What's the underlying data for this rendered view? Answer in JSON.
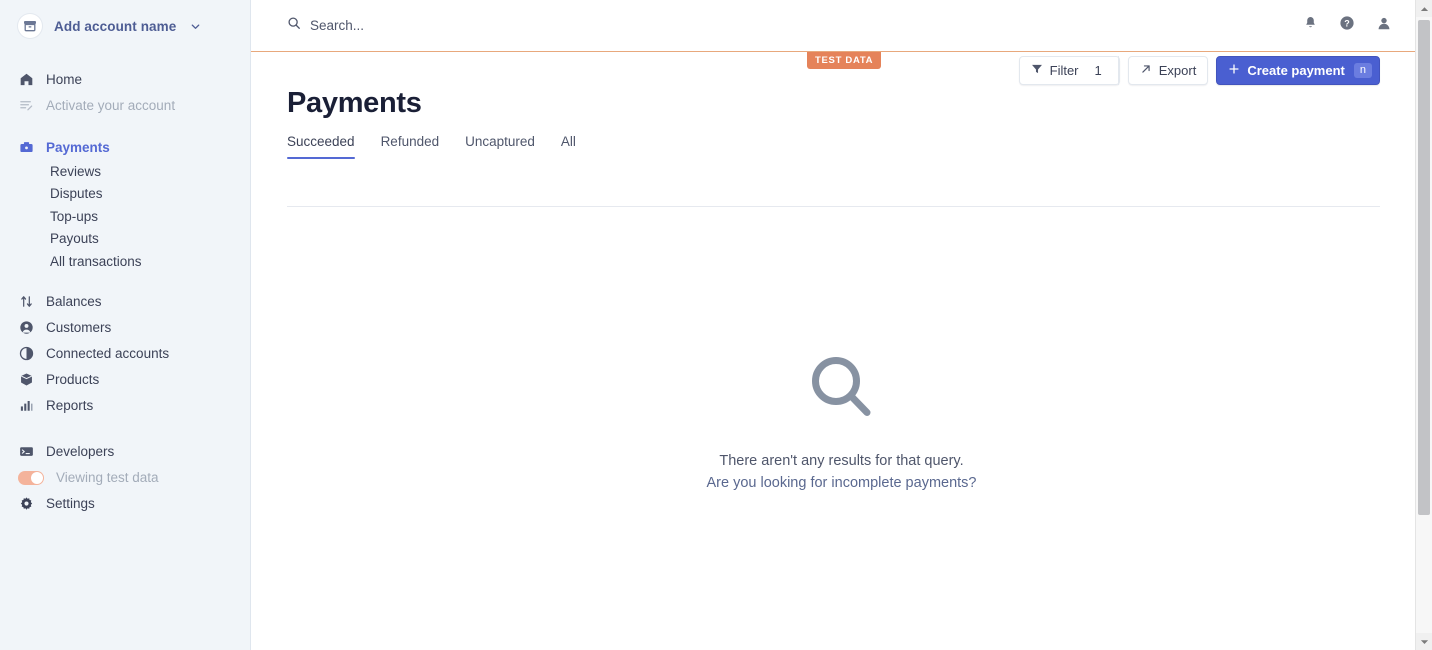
{
  "sidebar": {
    "account": {
      "label": "Add account name",
      "icon": "archive-box-icon",
      "chevron": "chevron-down-icon"
    },
    "items": [
      {
        "label": "Home",
        "icon": "home-icon",
        "state": "normal"
      },
      {
        "label": "Activate your account",
        "icon": "checklist-icon",
        "state": "muted"
      },
      {
        "label": "Payments",
        "icon": "payments-icon",
        "state": "active"
      },
      {
        "label": "Balances",
        "icon": "balances-arrows-icon",
        "state": "normal"
      },
      {
        "label": "Customers",
        "icon": "customers-person-icon",
        "state": "normal"
      },
      {
        "label": "Connected accounts",
        "icon": "connected-accounts-pie-icon",
        "state": "normal"
      },
      {
        "label": "Products",
        "icon": "products-box-icon",
        "state": "normal"
      },
      {
        "label": "Reports",
        "icon": "reports-bar-chart-icon",
        "state": "normal"
      },
      {
        "label": "Developers",
        "icon": "developers-terminal-icon",
        "state": "normal"
      },
      {
        "label": "Viewing test data",
        "icon": "toggle-switch-icon",
        "state": "muted"
      },
      {
        "label": "Settings",
        "icon": "gear-icon",
        "state": "normal"
      }
    ],
    "subitems": [
      {
        "label": "Reviews"
      },
      {
        "label": "Disputes"
      },
      {
        "label": "Top-ups"
      },
      {
        "label": "Payouts"
      },
      {
        "label": "All transactions"
      }
    ]
  },
  "header": {
    "search_placeholder": "Search...",
    "icons": [
      {
        "name": "notifications-bell-icon"
      },
      {
        "name": "help-question-icon"
      },
      {
        "name": "account-avatar-icon"
      }
    ],
    "test_data_badge": "TEST DATA"
  },
  "main": {
    "title": "Payments",
    "tabs": [
      {
        "label": "Succeeded",
        "active": true
      },
      {
        "label": "Refunded",
        "active": false
      },
      {
        "label": "Uncaptured",
        "active": false
      },
      {
        "label": "All",
        "active": false
      }
    ],
    "actions": {
      "filter_label": "Filter",
      "filter_count": "1",
      "export_label": "Export",
      "create_label": "Create payment",
      "create_shortcut": "n"
    },
    "empty_state": {
      "icon": "magnifier-search-icon",
      "message": "There aren't any results for that query.",
      "link": "Are you looking for incomplete payments?"
    }
  },
  "colors": {
    "accent": "#5469d4",
    "primary_button": "#4a5fd1",
    "test_data": "#e5835a",
    "sidebar_bg": "#f1f5f9"
  }
}
